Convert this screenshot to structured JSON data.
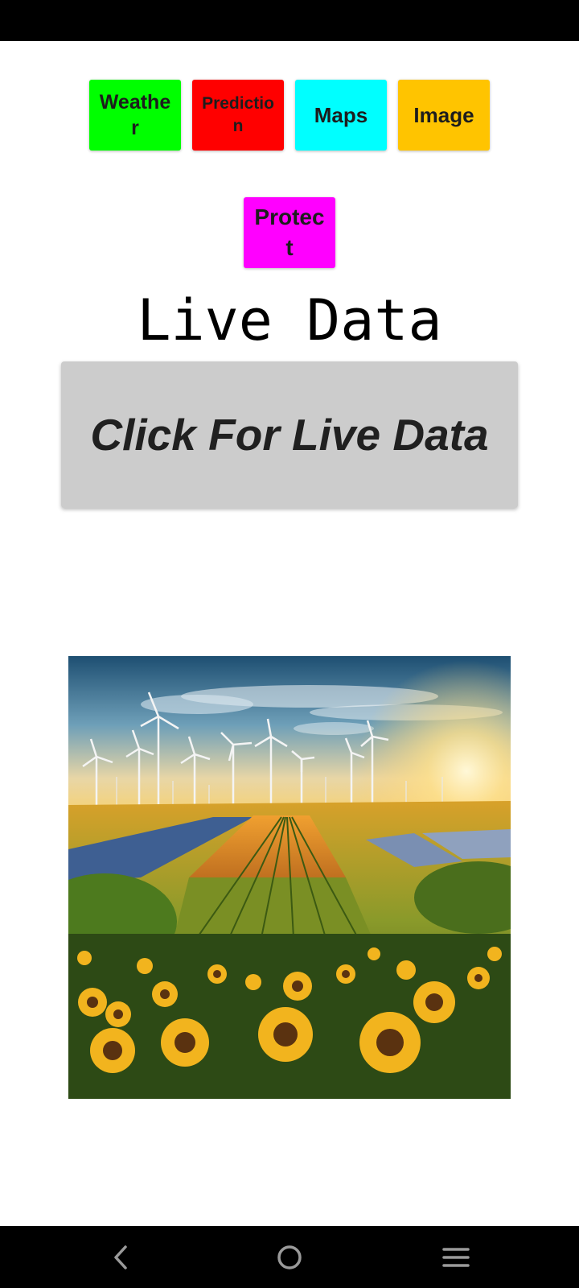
{
  "nav_buttons": {
    "weather": {
      "label": "Weather",
      "color": "#00ff00"
    },
    "prediction": {
      "label": "Prediction",
      "color": "#ff0000"
    },
    "maps": {
      "label": "Maps",
      "color": "#00ffff"
    },
    "image": {
      "label": "Image",
      "color": "#ffc400"
    },
    "protect": {
      "label": "Protect",
      "color": "#ff00ff"
    }
  },
  "main": {
    "title": "Live Data",
    "live_button_label": "Click For Live Data"
  },
  "system_nav": {
    "back_icon": "chevron-left-icon",
    "home_icon": "circle-home-icon",
    "menu_icon": "hamburger-menu-icon"
  }
}
